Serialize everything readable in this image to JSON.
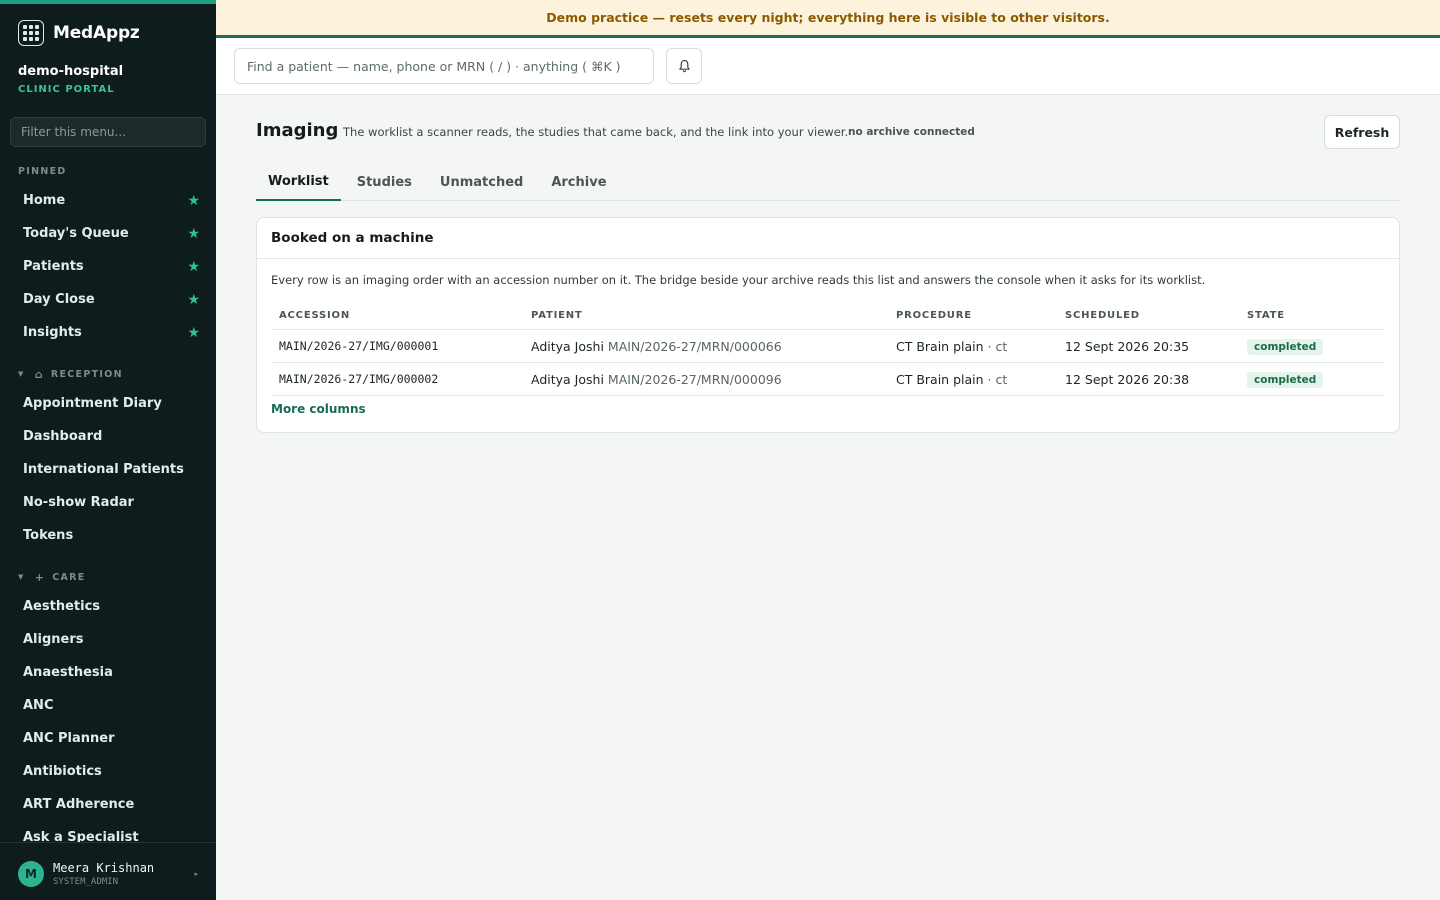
{
  "app": {
    "name": "MedAppz",
    "org": "demo-hospital",
    "portal": "CLINIC PORTAL"
  },
  "banner": "Demo practice — resets every night; everything here is visible to other visitors.",
  "sidebar": {
    "filter_placeholder": "Filter this menu...",
    "pinned_label": "PINNED",
    "pinned": [
      {
        "label": "Home"
      },
      {
        "label": "Today's Queue"
      },
      {
        "label": "Patients"
      },
      {
        "label": "Day Close"
      },
      {
        "label": "Insights"
      }
    ],
    "reception_label": "RECEPTION",
    "reception": [
      {
        "label": "Appointment Diary"
      },
      {
        "label": "Dashboard"
      },
      {
        "label": "International Patients"
      },
      {
        "label": "No-show Radar"
      },
      {
        "label": "Tokens"
      }
    ],
    "care_label": "CARE",
    "care": [
      {
        "label": "Aesthetics"
      },
      {
        "label": "Aligners"
      },
      {
        "label": "Anaesthesia"
      },
      {
        "label": "ANC"
      },
      {
        "label": "ANC Planner"
      },
      {
        "label": "Antibiotics"
      },
      {
        "label": "ART Adherence"
      },
      {
        "label": "Ask a Specialist"
      }
    ],
    "user": {
      "initial": "M",
      "name": "Meera Krishnan",
      "role": "SYSTEM_ADMIN"
    }
  },
  "topbar": {
    "search_placeholder": "Find a patient — name, phone or MRN ( / ) · anything ( ⌘K )"
  },
  "page": {
    "title": "Imaging",
    "description": "The worklist a scanner reads, the studies that came back, and the link into your viewer.",
    "archive_status": "no archive connected",
    "refresh_label": "Refresh",
    "tabs": [
      {
        "label": "Worklist"
      },
      {
        "label": "Studies"
      },
      {
        "label": "Unmatched"
      },
      {
        "label": "Archive"
      }
    ]
  },
  "card": {
    "title": "Booked on a machine",
    "description": "Every row is an imaging order with an accession number on it. The bridge beside your archive reads this list and answers the console when it asks for its worklist.",
    "columns": [
      "ACCESSION",
      "PATIENT",
      "PROCEDURE",
      "SCHEDULED",
      "STATE"
    ],
    "rows": [
      {
        "accession": "MAIN/2026-27/IMG/000001",
        "patient": "Aditya Joshi",
        "mrn": "MAIN/2026-27/MRN/000066",
        "procedure": "CT Brain plain",
        "modality": "· ct",
        "scheduled": "12 Sept 2026 20:35",
        "state": "completed"
      },
      {
        "accession": "MAIN/2026-27/IMG/000002",
        "patient": "Aditya Joshi",
        "mrn": "MAIN/2026-27/MRN/000096",
        "procedure": "CT Brain plain",
        "modality": "· ct",
        "scheduled": "12 Sept 2026 20:38",
        "state": "completed"
      }
    ],
    "more_label": "More columns"
  },
  "icons": {
    "star": "star-icon",
    "bell": "bell-icon",
    "home": "home-icon",
    "plus": "plus-icon"
  },
  "colors": {
    "accent": "#1a6a58",
    "brand_green": "#2dc196",
    "sidebar_bg": "#0f1c1e",
    "banner_bg": "#fdf3dc",
    "banner_text": "#8a5a00"
  }
}
